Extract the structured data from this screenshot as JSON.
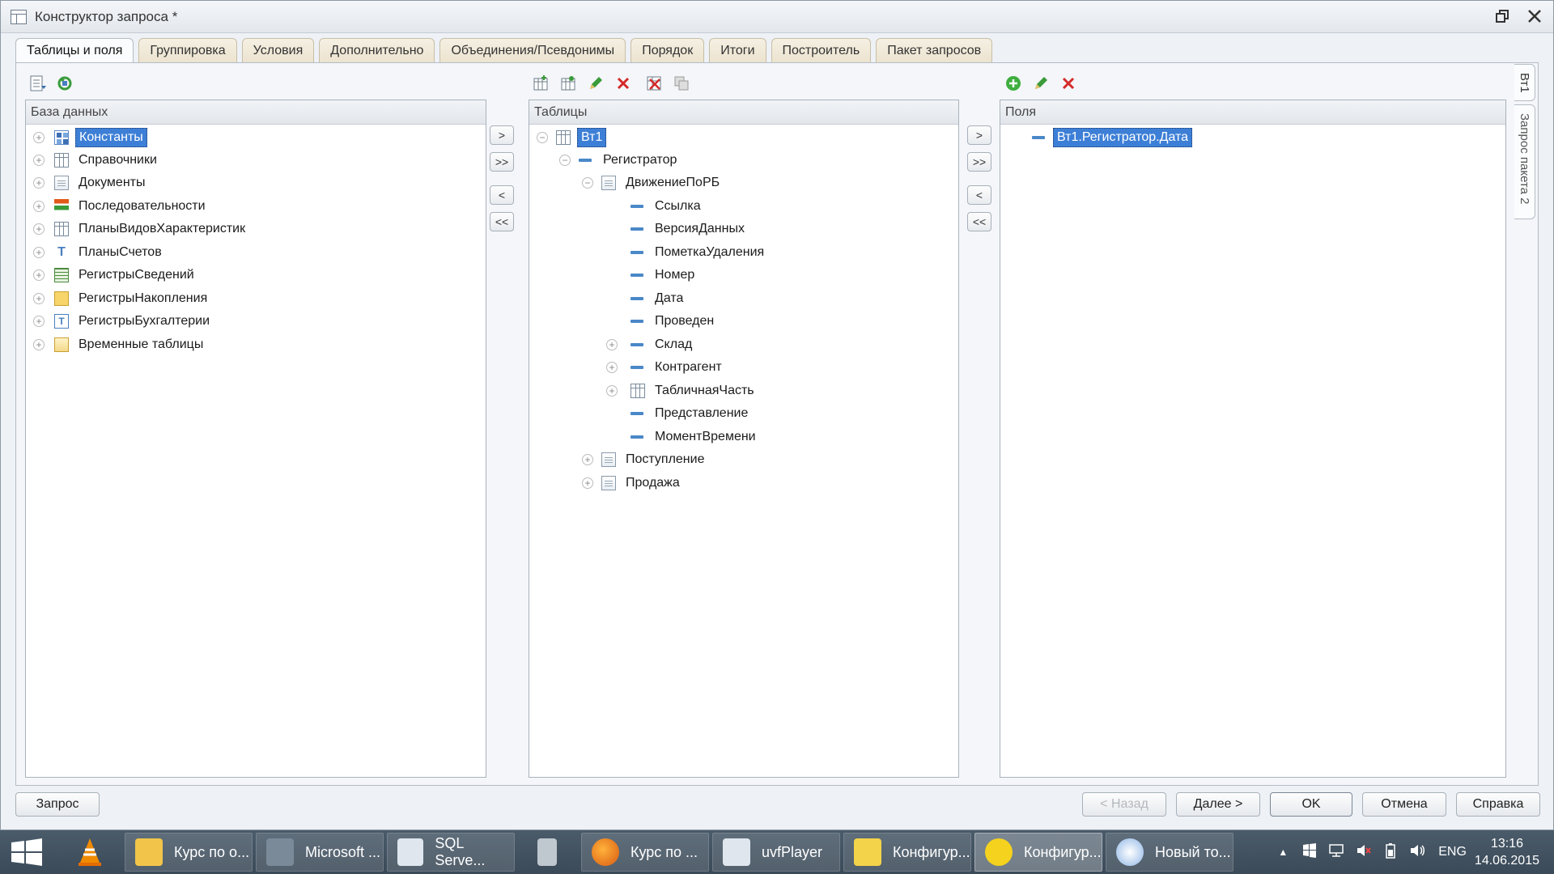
{
  "window": {
    "title": "Конструктор запроса *"
  },
  "tabs": [
    {
      "label": "Таблицы и поля"
    },
    {
      "label": "Группировка"
    },
    {
      "label": "Условия"
    },
    {
      "label": "Дополнительно"
    },
    {
      "label": "Объединения/Псевдонимы"
    },
    {
      "label": "Порядок"
    },
    {
      "label": "Итоги"
    },
    {
      "label": "Построитель"
    },
    {
      "label": "Пакет запросов"
    }
  ],
  "side_tabs": [
    {
      "label": "Вт1"
    },
    {
      "label": "Запрос пакета 2"
    }
  ],
  "database": {
    "header": "База данных",
    "items": [
      {
        "label": "Константы"
      },
      {
        "label": "Справочники"
      },
      {
        "label": "Документы"
      },
      {
        "label": "Последовательности"
      },
      {
        "label": "ПланыВидовХарактеристик"
      },
      {
        "label": "ПланыСчетов"
      },
      {
        "label": "РегистрыСведений"
      },
      {
        "label": "РегистрыНакопления"
      },
      {
        "label": "РегистрыБухгалтерии"
      },
      {
        "label": "Временные таблицы"
      }
    ]
  },
  "tables": {
    "header": "Таблицы",
    "root": "Вт1",
    "registrar": "Регистратор",
    "doc": "ДвижениеПоРБ",
    "fields": [
      {
        "label": "Ссылка"
      },
      {
        "label": "ВерсияДанных"
      },
      {
        "label": "ПометкаУдаления"
      },
      {
        "label": "Номер"
      },
      {
        "label": "Дата"
      },
      {
        "label": "Проведен"
      },
      {
        "label": "Склад"
      },
      {
        "label": "Контрагент"
      },
      {
        "label": "ТабличнаяЧасть"
      },
      {
        "label": "Представление"
      },
      {
        "label": "МоментВремени"
      }
    ],
    "other_docs": [
      {
        "label": "Поступление"
      },
      {
        "label": "Продажа"
      }
    ]
  },
  "fields": {
    "header": "Поля",
    "items": [
      {
        "label": "Вт1.Регистратор.Дата"
      }
    ]
  },
  "move_buttons": [
    ">",
    ">>",
    "<",
    "<<"
  ],
  "bottom": {
    "query": "Запрос",
    "back": "< Назад",
    "next": "Далее >",
    "ok": "OK",
    "cancel": "Отмена",
    "help": "Справка"
  },
  "taskbar": {
    "items": [
      {
        "label": "Курс по о..."
      },
      {
        "label": "Microsoft ..."
      },
      {
        "label": "SQL Serve..."
      },
      {
        "label": "Курс по ..."
      },
      {
        "label": "uvfPlayer"
      },
      {
        "label": "Конфигур..."
      },
      {
        "label": "Конфигур..."
      },
      {
        "label": "Новый то..."
      }
    ],
    "lang": "ENG",
    "time": "13:16",
    "date": "14.06.2015"
  }
}
